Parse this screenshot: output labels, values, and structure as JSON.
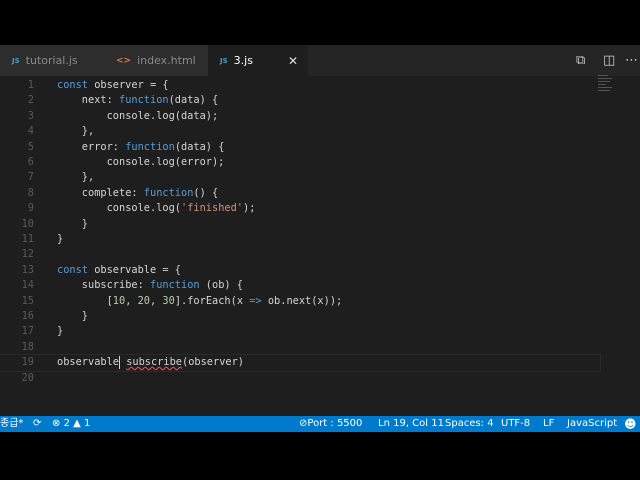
{
  "tabs": [
    {
      "label": "tutorial.js",
      "icon": "JS",
      "active": false
    },
    {
      "label": "index.html",
      "icon": "<>",
      "active": false
    },
    {
      "label": "3.js",
      "icon": "JS",
      "active": true
    }
  ],
  "toolbar": {
    "open_preview_icon": "search-preview-icon",
    "split_icon": "split-editor-icon",
    "more_icon": "ellipsis-icon"
  },
  "editor": {
    "lines": [
      {
        "n": "1",
        "t": [
          [
            "kw",
            "const"
          ],
          [
            "",
            "observer = {"
          ]
        ]
      },
      {
        "n": "2",
        "t": [
          [
            "",
            "    next: "
          ],
          [
            "kw",
            "function"
          ],
          [
            "",
            "(data) {"
          ]
        ]
      },
      {
        "n": "3",
        "t": [
          [
            "",
            "        console.log(data);"
          ]
        ]
      },
      {
        "n": "4",
        "t": [
          [
            "",
            "    },"
          ]
        ]
      },
      {
        "n": "5",
        "t": [
          [
            "",
            "    error: "
          ],
          [
            "kw",
            "function"
          ],
          [
            "",
            "(data) {"
          ]
        ]
      },
      {
        "n": "6",
        "t": [
          [
            "",
            "        console.log(error);"
          ]
        ]
      },
      {
        "n": "7",
        "t": [
          [
            "",
            "    },"
          ]
        ]
      },
      {
        "n": "8",
        "t": [
          [
            "",
            "    complete: "
          ],
          [
            "kw",
            "function"
          ],
          [
            "",
            "() {"
          ]
        ]
      },
      {
        "n": "9",
        "t": [
          [
            "",
            "        console.log("
          ],
          [
            "str",
            "'finished'"
          ],
          [
            "",
            ");"
          ]
        ]
      },
      {
        "n": "10",
        "t": [
          [
            "",
            "    }"
          ]
        ]
      },
      {
        "n": "11",
        "t": [
          [
            "",
            "}"
          ]
        ]
      },
      {
        "n": "12",
        "t": []
      },
      {
        "n": "13",
        "t": [
          [
            "kw",
            "const"
          ],
          [
            "",
            "observable = {"
          ]
        ]
      },
      {
        "n": "14",
        "t": [
          [
            "",
            "    subscribe: "
          ],
          [
            "kw",
            "function"
          ],
          [
            "",
            " (ob) {"
          ]
        ]
      },
      {
        "n": "15",
        "t": [
          [
            "",
            "        ["
          ],
          [
            "num",
            "10"
          ],
          [
            "",
            ", "
          ],
          [
            "num",
            "20"
          ],
          [
            "",
            ", "
          ],
          [
            "num",
            "30"
          ],
          [
            "",
            "].forEach(x "
          ],
          [
            "kw",
            "=>"
          ],
          [
            "",
            " ob.next(x));"
          ]
        ]
      },
      {
        "n": "16",
        "t": [
          [
            "",
            "    }"
          ]
        ]
      },
      {
        "n": "17",
        "t": [
          [
            "",
            "}"
          ]
        ]
      },
      {
        "n": "18",
        "t": []
      },
      {
        "n": "19",
        "t": [
          [
            "",
            "observable"
          ],
          [
            "caret",
            ""
          ],
          [
            "",
            " "
          ],
          [
            "sq",
            "subscribe"
          ],
          [
            "",
            "(observer)"
          ]
        ]
      },
      {
        "n": "20",
        "t": []
      }
    ]
  },
  "status": {
    "branch": "종급*",
    "errors": "2",
    "warnings": "1",
    "port": "Port : 5500",
    "position": "Ln 19, Col 11",
    "spaces": "Spaces: 4",
    "encoding": "UTF-8",
    "eol": "LF",
    "language": "JavaScript",
    "color": "#007acc"
  }
}
